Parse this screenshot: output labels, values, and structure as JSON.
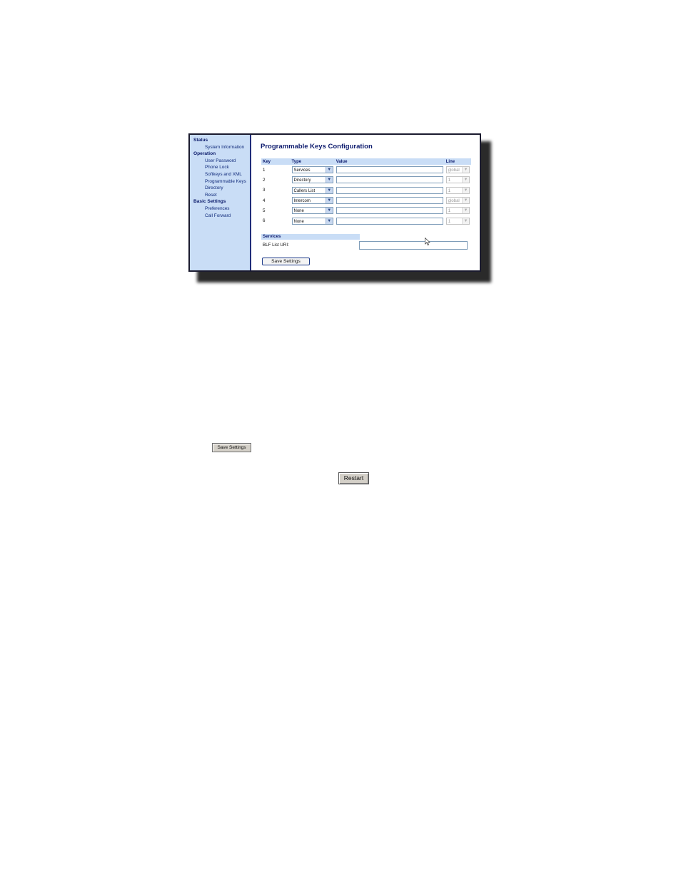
{
  "sidebar": {
    "sections": [
      {
        "heading": "Status",
        "items": [
          "System Information"
        ]
      },
      {
        "heading": "Operation",
        "items": [
          "User Password",
          "Phone Lock",
          "Softkeys and XML",
          "Programmable Keys",
          "Directory",
          "Reset"
        ]
      },
      {
        "heading": "Basic Settings",
        "items": [
          "Preferences",
          "Call Forward"
        ]
      }
    ]
  },
  "main": {
    "title": "Programmable Keys Configuration",
    "columns": {
      "key": "Key",
      "type": "Type",
      "value": "Value",
      "line": "Line"
    },
    "rows": [
      {
        "key": "1",
        "type": "Services",
        "value": "",
        "line": "global"
      },
      {
        "key": "2",
        "type": "Directory",
        "value": "",
        "line": "1"
      },
      {
        "key": "3",
        "type": "Callers List",
        "value": "",
        "line": "1"
      },
      {
        "key": "4",
        "type": "Intercom",
        "value": "",
        "line": "global"
      },
      {
        "key": "5",
        "type": "None",
        "value": "",
        "line": "1"
      },
      {
        "key": "6",
        "type": "None",
        "value": "",
        "line": "1"
      }
    ],
    "services_heading": "Services",
    "blf_label": "BLF List URI:",
    "blf_value": "",
    "save_label": "Save Settings"
  },
  "standalone": {
    "save_small_label": "Save Settings",
    "restart_label": "Restart"
  },
  "icons": {
    "dropdown": "chevron-down-icon",
    "cursor": "mouse-pointer-icon"
  },
  "colors": {
    "sidebar_bg": "#c9ddf6",
    "header_bg": "#c9ddf6",
    "title": "#0d1b6e",
    "border": "#1f2c7a"
  }
}
